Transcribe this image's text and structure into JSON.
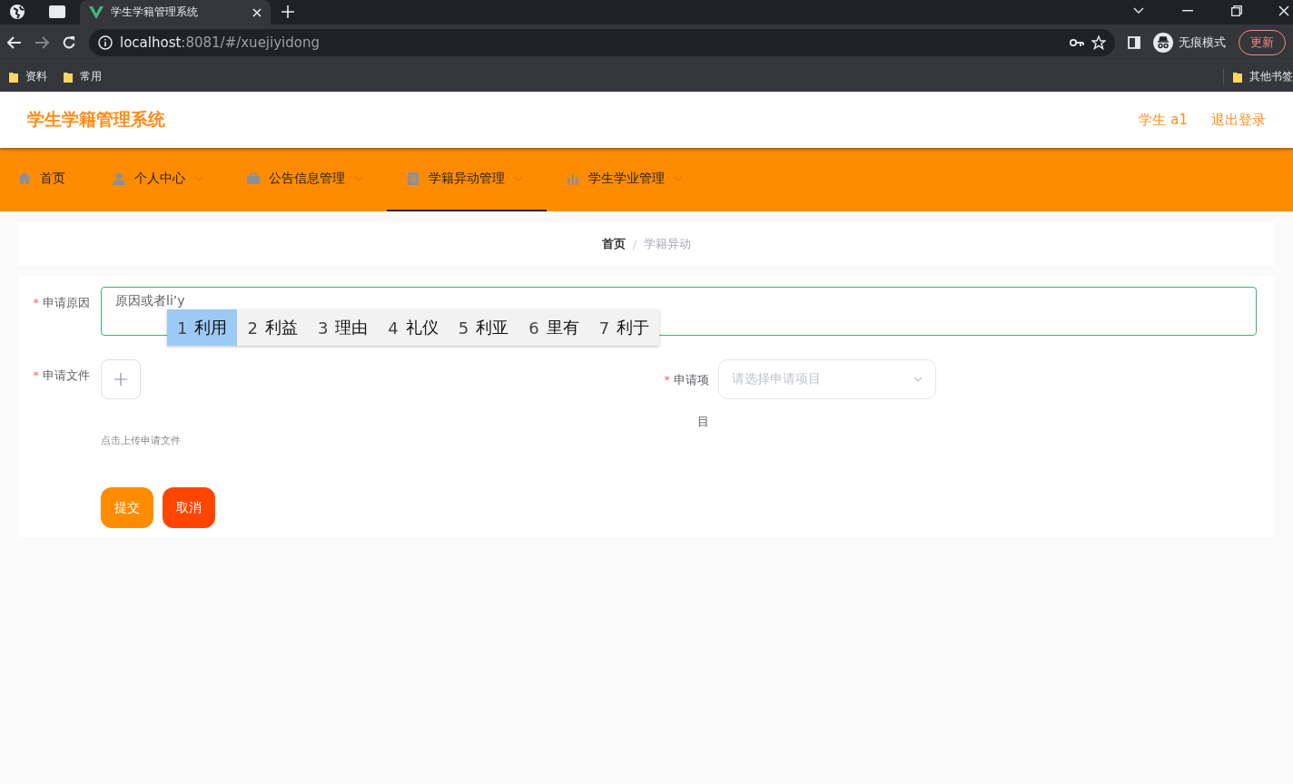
{
  "browser": {
    "tabs": [
      {
        "title": "学生学籍管理系统",
        "selected": true
      }
    ],
    "url_host": "localhost",
    "url_path": ":8081/#/xuejiyidong",
    "profile": "无痕模式",
    "update_button": "更新",
    "bookmarks": [
      {
        "label": "资料"
      },
      {
        "label": "常用"
      }
    ],
    "other_bookmarks": "其他书签"
  },
  "app": {
    "title": "学生学籍管理系统",
    "user": "学生 a1",
    "logout": "退出登录"
  },
  "nav": [
    {
      "label": "首页",
      "dropdown": false,
      "selected": false
    },
    {
      "label": "个人中心",
      "dropdown": true,
      "selected": false
    },
    {
      "label": "公告信息管理",
      "dropdown": true,
      "selected": false
    },
    {
      "label": "学籍异动管理",
      "dropdown": true,
      "selected": true
    },
    {
      "label": "学生学业管理",
      "dropdown": true,
      "selected": false
    }
  ],
  "breadcrumb": {
    "separator": "/",
    "items": [
      {
        "label": "首页",
        "current": false
      },
      {
        "label": "学籍异动",
        "current": true
      }
    ]
  },
  "form": {
    "required_mark": "*",
    "reason": {
      "label": "申请原因",
      "required": true,
      "value": "原因或者li’y"
    },
    "ime_candidates": [
      {
        "number": "1",
        "text": "利用",
        "selected": true
      },
      {
        "number": "2",
        "text": "利益",
        "selected": false
      },
      {
        "number": "3",
        "text": "理由",
        "selected": false
      },
      {
        "number": "4",
        "text": "礼仪",
        "selected": false
      },
      {
        "number": "5",
        "text": "利亚",
        "selected": false
      },
      {
        "number": "6",
        "text": "里有",
        "selected": false
      },
      {
        "number": "7",
        "text": "利于",
        "selected": false
      }
    ],
    "file": {
      "label": "申请文件",
      "required": true,
      "hint": "点击上传申请文件"
    },
    "item": {
      "label": "申请项目",
      "required": true,
      "placeholder": "请选择申请项目"
    },
    "buttons": [
      {
        "label": "提交",
        "kind": "primary"
      },
      {
        "label": "取消",
        "kind": "danger"
      }
    ]
  }
}
